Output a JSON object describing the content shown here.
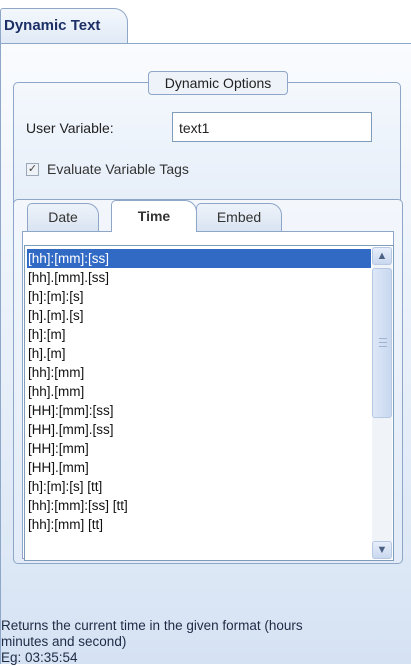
{
  "tab": {
    "title": "Dynamic Text"
  },
  "dynamic_options": {
    "legend": "Dynamic Options",
    "user_variable_label": "User Variable:",
    "user_variable_value": "text1",
    "evaluate_tags_label": "Evaluate Variable Tags",
    "evaluate_tags_checked": true
  },
  "format_tabs": [
    {
      "label": "Date",
      "active": false
    },
    {
      "label": "Time",
      "active": true
    },
    {
      "label": "Embed",
      "active": false
    }
  ],
  "format_list": {
    "selected_index": 0,
    "items": [
      "[hh]:[mm]:[ss]",
      "[hh].[mm].[ss]",
      "[h]:[m]:[s]",
      "[h].[m].[s]",
      "[h]:[m]",
      "[h].[m]",
      "[hh]:[mm]",
      "[hh].[mm]",
      "[HH]:[mm]:[ss]",
      "[HH].[mm].[ss]",
      "[HH]:[mm]",
      "[HH].[mm]",
      "[h]:[m]:[s] [tt]",
      "[hh]:[mm]:[ss] [tt]",
      "[hh]:[mm] [tt]"
    ]
  },
  "help": {
    "lines": [
      "Returns the current time in the given format (hours",
      "minutes and second)",
      "Eg: 03:35:54"
    ]
  },
  "icons": {
    "scroll_up": "chevron-up-icon",
    "scroll_down": "chevron-down-icon",
    "checkbox": "checkmark-icon"
  }
}
